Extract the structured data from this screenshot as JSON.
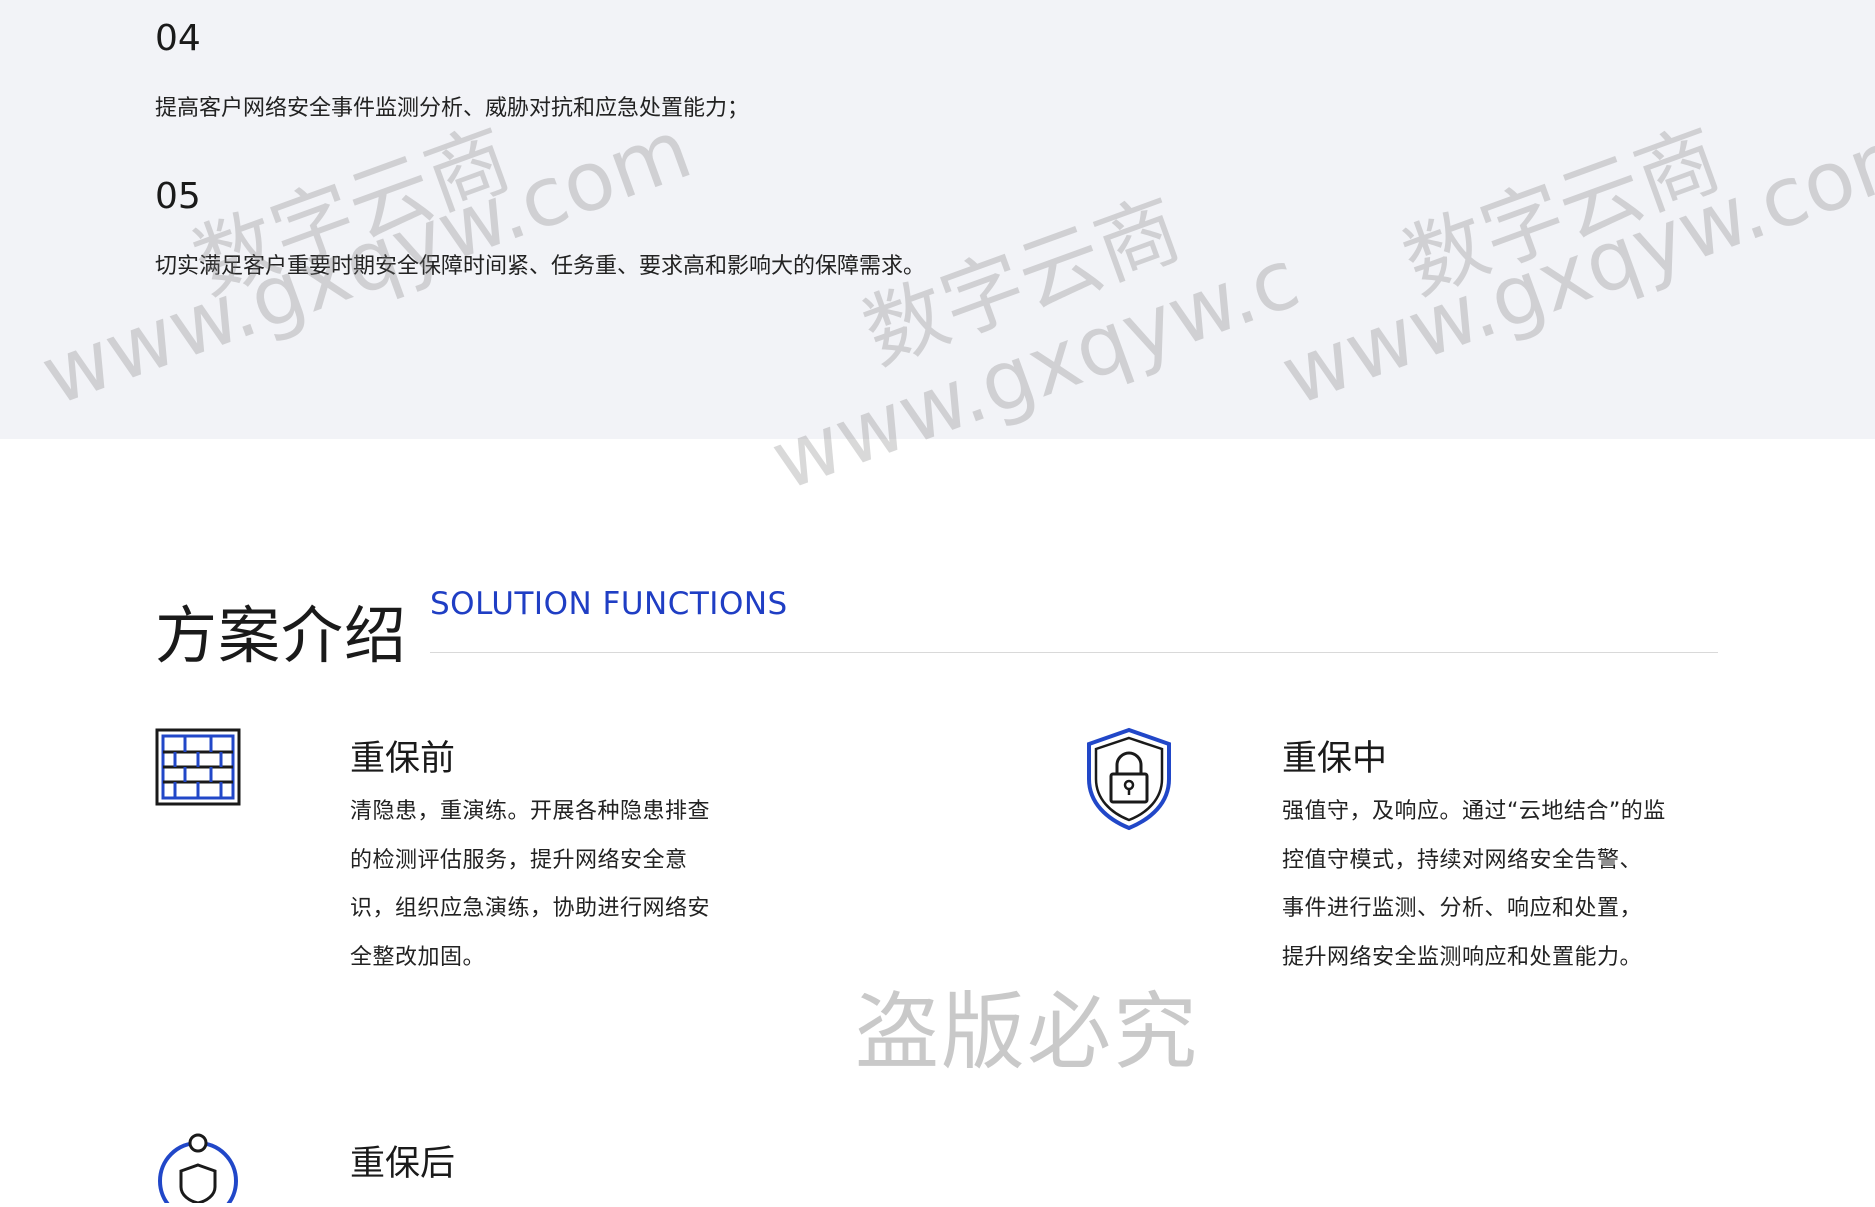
{
  "top_list": [
    {
      "num": "04",
      "text": "提高客户网络安全事件监测分析、威胁对抗和应急处置能力；"
    },
    {
      "num": "05",
      "text": "切实满足客户重要时期安全保障时间紧、任务重、要求高和影响大的保障需求。"
    }
  ],
  "section": {
    "title": "方案介绍",
    "subtitle": "SOLUTION FUNCTIONS",
    "accent_color": "#1f3ec4"
  },
  "features": [
    {
      "title": "重保前",
      "icon": "firewall-icon",
      "lines": [
        "清隐患，重演练。开展各种隐患排查",
        "的检测评估服务，提升网络安全意",
        "识，组织应急演练，协助进行网络安",
        "全整改加固。"
      ]
    },
    {
      "title": "重保中",
      "icon": "shield-lock-icon",
      "lines": [
        "强值守，及响应。通过“云地结合”的监",
        "控值守模式，持续对网络安全告警、",
        "事件进行监测、分析、响应和处置，",
        "提升网络安全监测响应和处置能力。"
      ]
    },
    {
      "title": "重保后",
      "icon": "shield-orbit-icon",
      "lines": []
    }
  ],
  "watermark": {
    "brand": "数字云商",
    "url": "www.gxqyw.com",
    "url_partial_1": "www.gxqyw.c",
    "url_partial_2": "www.gxqyw.com",
    "stamp": "盗版必究"
  }
}
